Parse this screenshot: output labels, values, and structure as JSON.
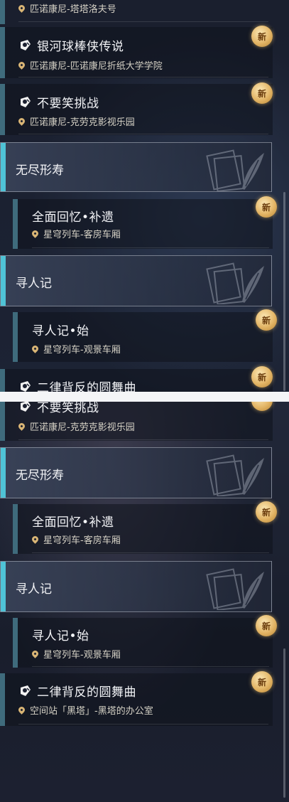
{
  "panel_top": {
    "item_partial": {
      "location": "匹诺康尼-塔塔洛夫号"
    },
    "item_galaxy": {
      "title": "银河球棒侠传说",
      "location": "匹诺康尼-匹诺康尼折纸大学学院",
      "badge": "新"
    },
    "item_dontlaugh": {
      "title": "不要笑挑战",
      "location": "匹诺康尼-克劳克影视乐园",
      "badge": "新"
    },
    "chapter_endless": {
      "title": "无尽形寿"
    },
    "item_recall": {
      "title": "全面回忆•补遗",
      "location": "星穹列车-客房车厢",
      "badge": "新"
    },
    "chapter_search": {
      "title": "寻人记"
    },
    "item_search_start": {
      "title": "寻人记•始",
      "location": "星穹列车-观景车厢",
      "badge": "新"
    },
    "item_rondo": {
      "title": "二律背反的圆舞曲",
      "badge": "新"
    }
  },
  "panel_bottom": {
    "item_dontlaugh": {
      "title": "不要笑挑战",
      "location": "匹诺康尼-克劳克影视乐园"
    },
    "chapter_endless": {
      "title": "无尽形寿"
    },
    "item_recall": {
      "title": "全面回忆•补遗",
      "location": "星穹列车-客房车厢",
      "badge": "新"
    },
    "chapter_search": {
      "title": "寻人记"
    },
    "item_search_start": {
      "title": "寻人记•始",
      "location": "星穹列车-观景车厢",
      "badge": "新"
    },
    "item_rondo": {
      "title": "二律背反的圆舞曲",
      "location": "空间站「黑塔」-黑塔的办公室",
      "badge": "新"
    }
  },
  "colors": {
    "accent_cyan": "#4fc3d6",
    "accent_teal": "#3f6b7c",
    "pin_gold": "#d9b575",
    "badge_gold": "#e3b566"
  }
}
